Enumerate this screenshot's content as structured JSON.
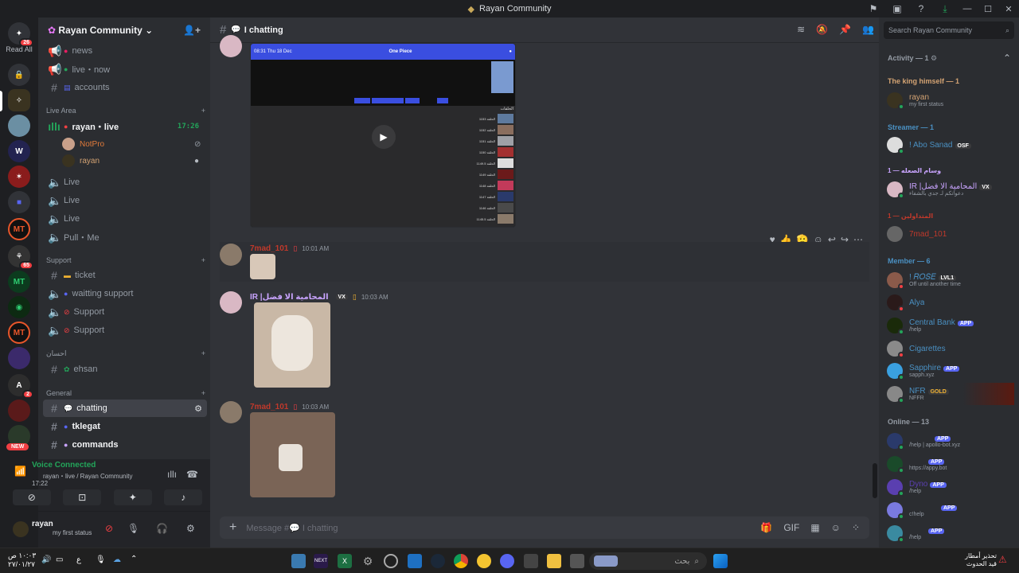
{
  "window": {
    "title": "Rayan Community"
  },
  "servers": {
    "read_all": "Read All",
    "badges": [
      "26",
      "65",
      "2"
    ],
    "new_label": "NEW"
  },
  "guild": {
    "name": "Rayan Community",
    "channels_top": [
      {
        "label": "news",
        "prefix": "I"
      },
      {
        "label": "live・now",
        "prefix": "I"
      },
      {
        "label": "accounts",
        "prefix": "I"
      }
    ],
    "live_area": {
      "category": "Live Area",
      "active_voice": "rayan・live",
      "active_time": "17:26",
      "users": [
        "NotPro",
        "rayan"
      ],
      "voice_channels": [
        "Live",
        "Live",
        "Live",
        "Pull・Me"
      ]
    },
    "support": {
      "category": "Support",
      "channels": [
        "ticket",
        "waitting support",
        "Support",
        "Support"
      ]
    },
    "ehsan": {
      "category": "احسان",
      "channels": [
        "ehsan"
      ]
    },
    "general": {
      "category": "General",
      "channels": [
        "chatting",
        "tklegat",
        "commands"
      ]
    }
  },
  "voice": {
    "status": "Voice Connected",
    "location": "rayan・live / Rayan Community",
    "time": "17:22"
  },
  "user": {
    "name": "rayan",
    "status": "my first status"
  },
  "chat": {
    "channel": "chatting",
    "messages": [
      {
        "author": "7mad_101",
        "time": "10:01 AM",
        "color": "#c0392b"
      },
      {
        "author": "IR |المحامية الا فضل",
        "time": "10:03 AM",
        "color": "#c9a4ff",
        "tag": "VX"
      },
      {
        "author": "7mad_101",
        "time": "10:03 AM",
        "color": "#c0392b"
      }
    ],
    "embed": {
      "app_title": "One Piece",
      "header_time": "08:31 Thu 18 Dec",
      "section": "الحلقات",
      "episodes": [
        "الحلقة 1153",
        "الحلقة 1152",
        "الحلقة 1151",
        "الحلقة 1150",
        "الحلقة 1149.5",
        "الحلقة 1149",
        "الحلقة 1148",
        "الحلقة 1147",
        "الحلقة 1146",
        "الحلقة 1145.5"
      ]
    },
    "composer_placeholder": "Message #💬 I chatting"
  },
  "members": {
    "search_placeholder": "Search Rayan Community",
    "activity": "Activity — 1",
    "groups": [
      {
        "title": "The king himself — 1",
        "color": "#d4a373"
      },
      {
        "title": "Streamer — 1",
        "color": "#4a90c2"
      },
      {
        "title": "وسام الصعله — 1",
        "color": "#c9a4ff"
      },
      {
        "title": "المتداولين — 1",
        "color": "#c0392b"
      },
      {
        "title": "Member — 6",
        "color": "#4a90c2"
      },
      {
        "title": "Online — 13",
        "color": "#949ba4"
      }
    ],
    "list": [
      {
        "name": "rayan",
        "sub": "my first status",
        "color": "#d4a373"
      },
      {
        "name": "! Abo Sanad",
        "sub": "",
        "color": "#4a90c2",
        "tag": "OSF"
      },
      {
        "name": "IR |المحامية الا فضل",
        "sub": "دعواتكم لـ جدي بالشفاء",
        "color": "#c9a4ff",
        "tag": "VX"
      },
      {
        "name": "7mad_101",
        "sub": "",
        "color": "#c0392b"
      },
      {
        "name": "! 𝑅𝑂𝑆𝐸",
        "sub": "Off until another time",
        "color": "#4a90c2",
        "tag": "LVL1"
      },
      {
        "name": "Alya",
        "sub": "",
        "color": "#4a90c2"
      },
      {
        "name": "Central Bank",
        "sub": "/help",
        "color": "#4a90c2",
        "tag": "APP"
      },
      {
        "name": "Cigarettes",
        "sub": "",
        "color": "#4a90c2"
      },
      {
        "name": "Sapphire",
        "sub": "sapph.xyz",
        "color": "#4a90c2",
        "tag": "APP"
      },
      {
        "name": "NFR",
        "sub": "NFFR",
        "color": "#4a90c2",
        "tag": "GOLD"
      },
      {
        "name": "",
        "sub": "/help | apollo-bot.xyz",
        "color": "#949ba4",
        "tag": "APP"
      },
      {
        "name": "",
        "sub": "https://appy.bot",
        "color": "#949ba4",
        "tag": "APP"
      },
      {
        "name": "Dyno",
        "sub": "/help",
        "color": "#5a3fb0",
        "tag": "APP"
      },
      {
        "name": "",
        "sub": "c!help",
        "color": "#949ba4",
        "tag": "APP"
      },
      {
        "name": "",
        "sub": "/help",
        "color": "#949ba4",
        "tag": "APP"
      }
    ]
  },
  "taskbar": {
    "clock_time": "١٠:٠٣ ص",
    "clock_date": "٢٧/٠١/٢٧",
    "search": "بحث",
    "weather_title": "تحذير أمطار",
    "weather_sub": "قيد الحدوث",
    "lang": "ع"
  }
}
